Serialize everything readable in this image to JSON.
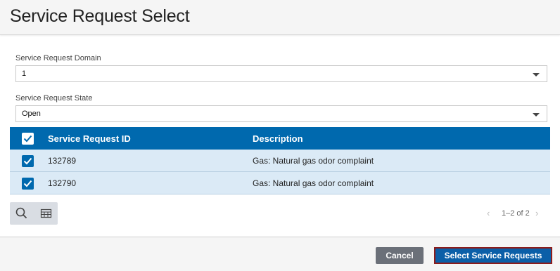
{
  "dialog": {
    "title": "Service Request Select"
  },
  "form": {
    "domain": {
      "label": "Service Request Domain",
      "value": "1"
    },
    "state": {
      "label": "Service Request State",
      "value": "Open"
    }
  },
  "grid": {
    "columns": {
      "id": "Service Request ID",
      "description": "Description"
    },
    "rows": [
      {
        "id": "132789",
        "description": "Gas: Natural gas odor complaint",
        "checked": true
      },
      {
        "id": "132790",
        "description": "Gas: Natural gas odor complaint",
        "checked": true
      }
    ]
  },
  "pager": {
    "text": "1–2 of 2"
  },
  "footer": {
    "cancel_label": "Cancel",
    "select_label": "Select Service Requests"
  },
  "colors": {
    "header_blue": "#0069ae",
    "row_selected": "#dbeaf6",
    "cancel_gray": "#6b7079",
    "focus_outline": "#8b1c1c"
  }
}
